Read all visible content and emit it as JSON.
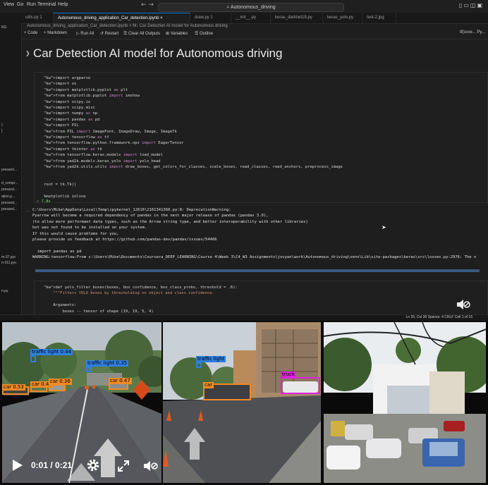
{
  "vscode": {
    "menu": [
      "View",
      "Go",
      "Run",
      "Terminal",
      "Help"
    ],
    "command_center": "Autonomous_driving",
    "left_fragments": [
      "NG",
      ")",
      "]",
      "d_compr...",
      "pressed...",
      "pressed...",
      "ation.p...",
      "pressed...",
      "pressed...",
      "m-37.pyc",
      "n-311.pyc",
      "n.py"
    ],
    "tabs": [
      {
        "label": "utils.py 1"
      },
      {
        "label": "Autonomous_driving_application_Car_detection.ipynb",
        "active": true
      },
      {
        "label": "draw.py 1"
      },
      {
        "label": "__init__.py"
      },
      {
        "label": "keras_darknet19.py"
      },
      {
        "label": "keras_yolo.py"
      },
      {
        "label": "test-2.jpg"
      }
    ],
    "breadcrumb": "Autonomous_driving_application_Car_detection.ipynb > M↓ Car Detection AI model for Autonomous driving",
    "toolbar": {
      "code": "+ Code",
      "markdown": "+ Markdown",
      "run_all": "▷ Run All",
      "restart": "↺ Restart",
      "clear": "☰ Clear All Outputs",
      "variables": "⊞ Variables",
      "outline": "☰ Outline",
      "kernel": "tf(ssve... Py..."
    },
    "markdown_title": "Car Detection AI model for Autonomous driving",
    "code_lines": [
      "import argparse",
      "import os",
      "import matplotlib.pyplot as plt",
      "from matplotlib.pyplot import imshow",
      "import scipy.io",
      "import scipy.misc",
      "import numpy as np",
      "import pandas as pd",
      "import PIL",
      "from PIL import ImageFont, ImageDraw, Image, ImageTk",
      "import tensorflow as tf",
      "from tensorflow.python.framework.ops import EagerTensor",
      "import tkinter as tk",
      "from tensorflow.keras.models import load_model",
      "from yad2k.models.keras_yolo import yolo_head",
      "from yad2k.utils.utils import draw_boxes, get_colors_for_classes, scale_boxes, read_classes, read_anchors, preprocess_image",
      "",
      "",
      "root = tk.Tk()",
      "",
      "%matplotlib inline"
    ],
    "exec_time": "✓ 7.8s",
    "output_lines": [
      "C:\\Users\\Mike\\AppData\\Local\\Temp\\ipykernel_12616\\2161341360.py:8: DeprecationWarning:",
      "Pyarrow will become a required dependency of pandas in the next major release of pandas (pandas 3.0),",
      "(to allow more performant data types, such as the Arrow string type, and better interoperability with other libraries)",
      "but was not found to be installed on your system.",
      "If this would cause problems for you,",
      "please provide us feedback at https://github.com/pandas-dev/pandas/issues/54466",
      "",
      "  import pandas as pd",
      "WARNING:tensorflow:From c:\\Users\\Mike\\Documents\\Coursera_DEEP_LEARNING\\Course 4\\Week 3\\C4_W3 Assignments\\jovyan\\work\\Autonomous_driving\\venv\\Lib\\site-packages\\keras\\src\\losses.py:2976: The n"
    ],
    "code2_lines": [
      "def yolo_filter_boxes(boxes, box_confidence, box_class_probs, threshold = .6):",
      "    \"\"\"Filters YOLO boxes by thresholding on object and class confidence.",
      "",
      "    Arguments:",
      "        boxes -- tensor of shape (19, 19, 5, 4)"
    ],
    "status": "Ln 26, Col 36   Spaces: 4   CRLF   Cell 1 of 16"
  },
  "photos": {
    "p1_labels": [
      "traffic light 0.44",
      "traffic light 0.35",
      "car 0.53",
      "car 0.49",
      "car 0.36",
      "car 0.47"
    ],
    "p2_labels": [
      "traffic light",
      "car",
      "truck"
    ]
  },
  "video": {
    "time": "0:01 / 0:21",
    "icons": [
      "play-icon",
      "gear-icon",
      "fullscreen-icon",
      "mute-icon"
    ]
  },
  "colors": {
    "accent": "#0078d4",
    "traffic_light_box": "#2f7fe0",
    "car_box": "#f08a24",
    "truck_box": "#e021e0"
  }
}
